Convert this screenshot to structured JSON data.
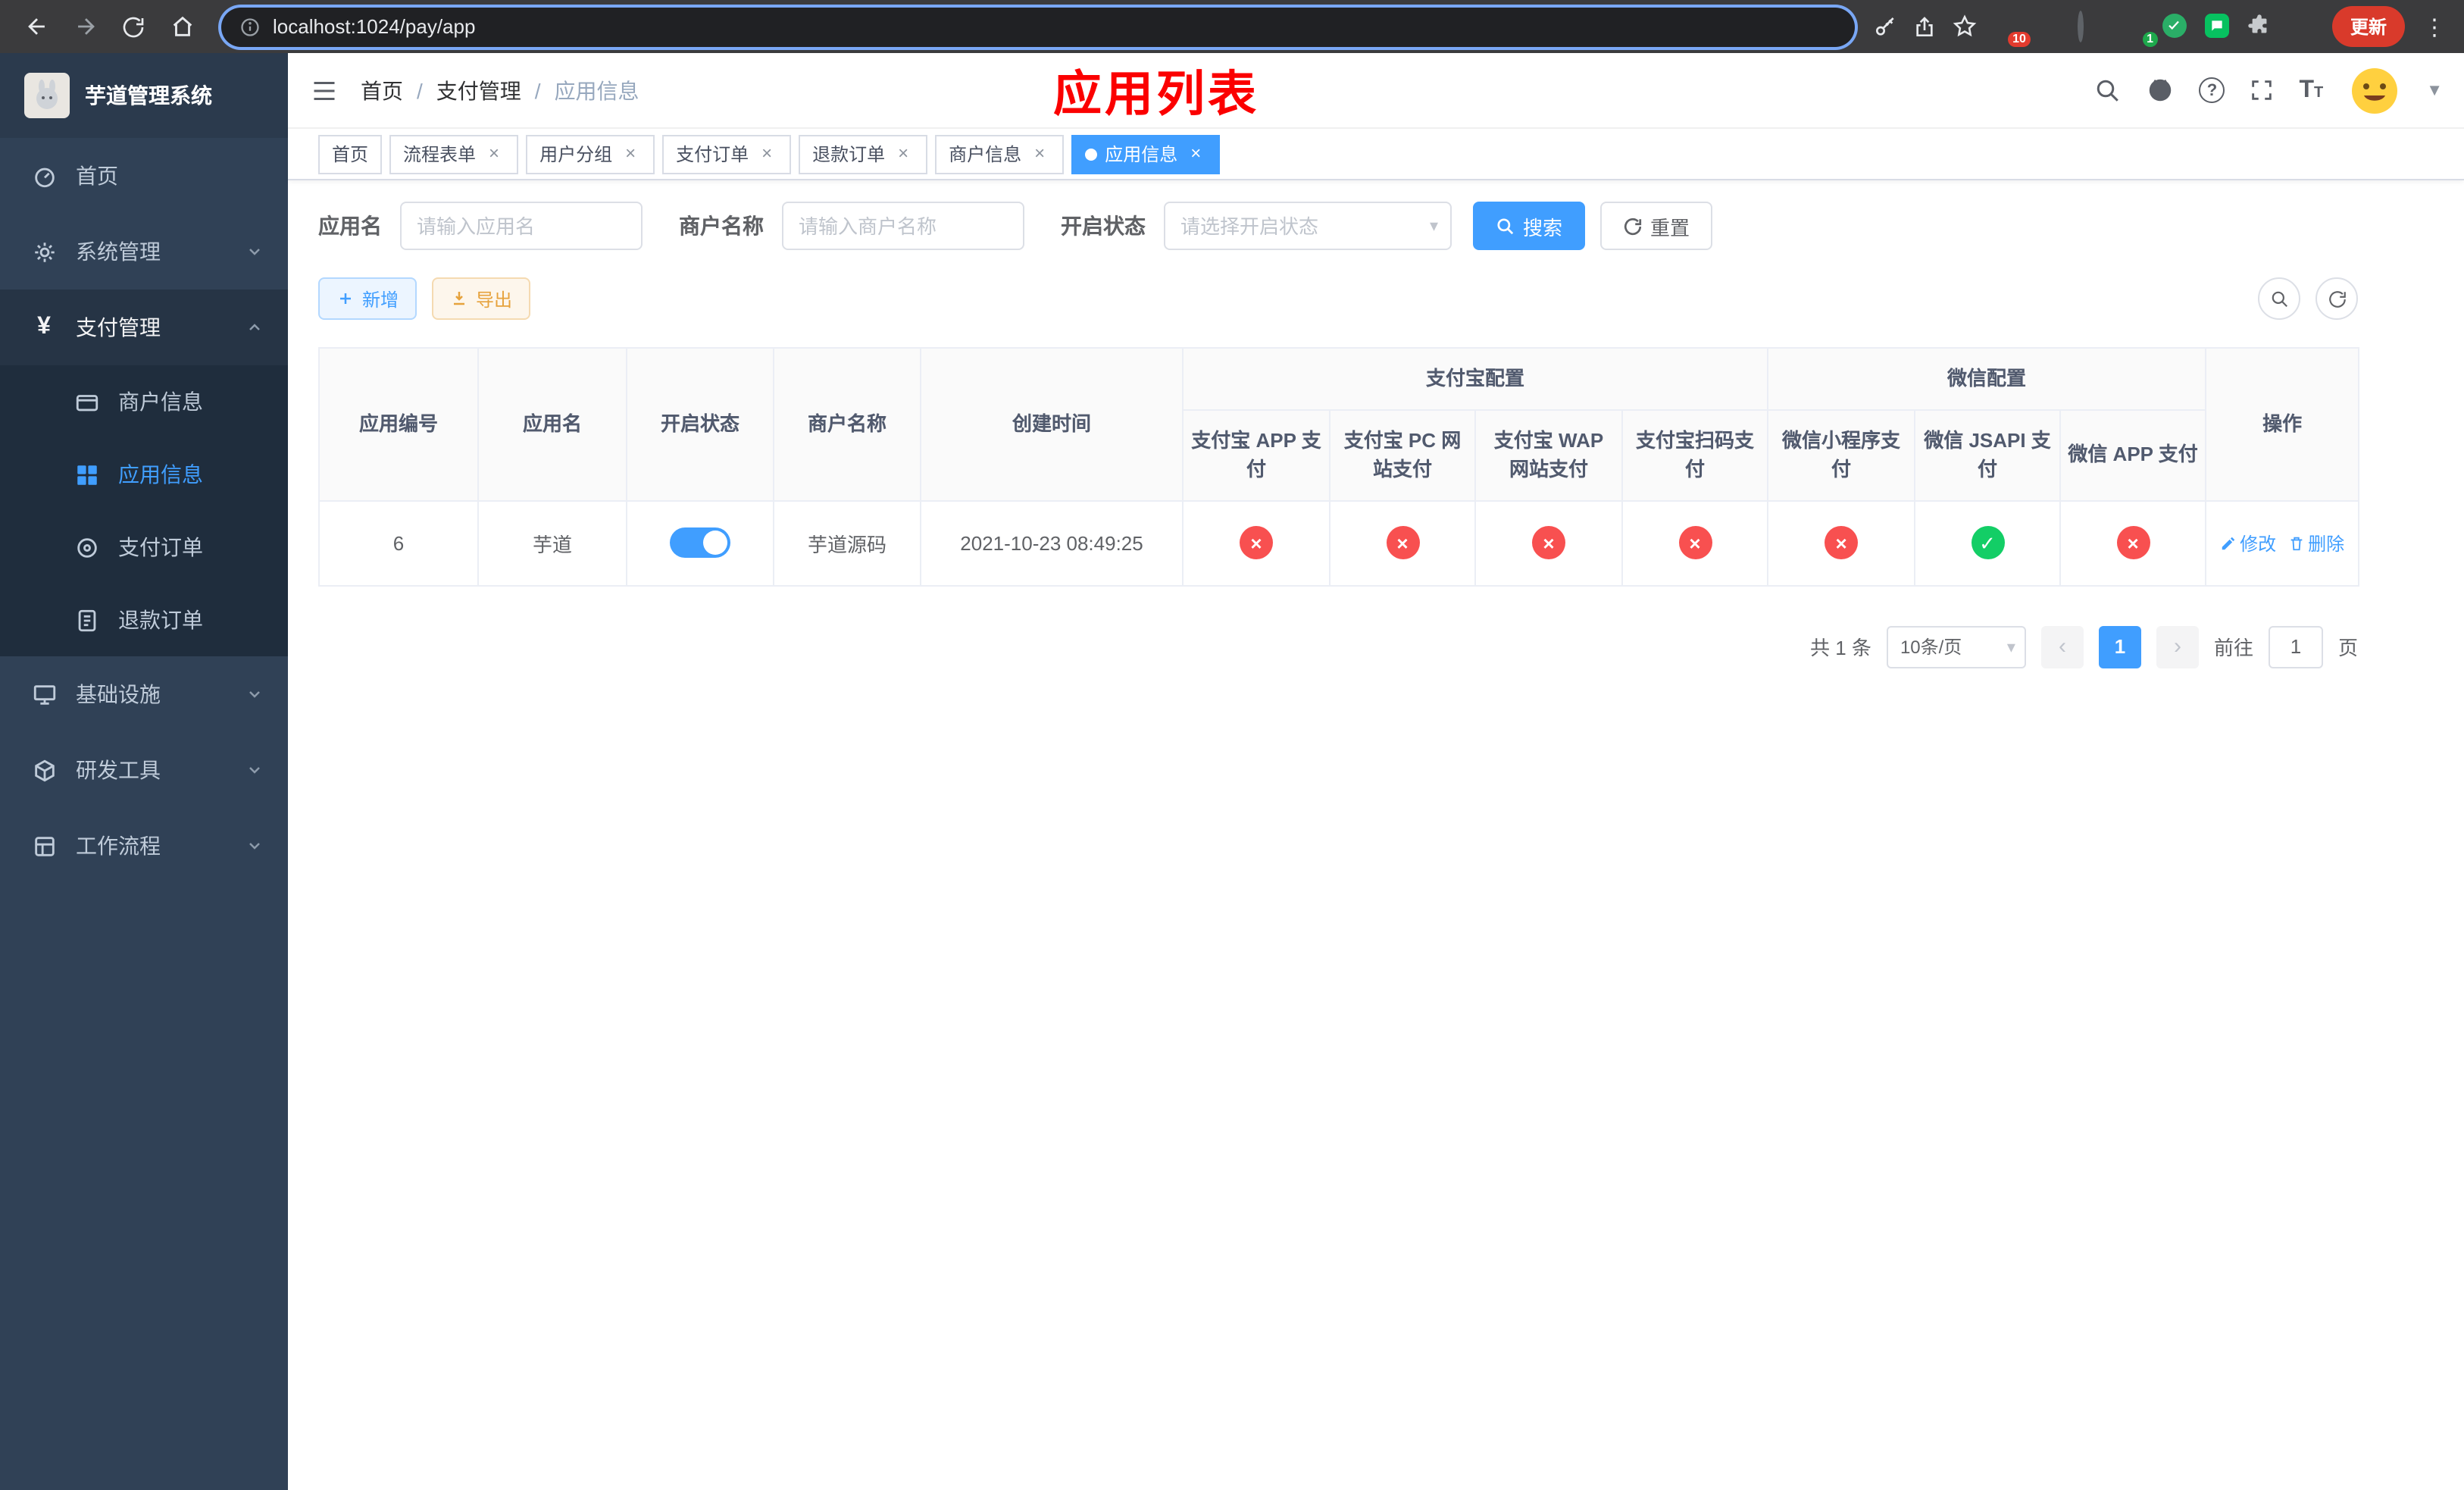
{
  "browser": {
    "url": "localhost:1024/pay/app",
    "update_button": "更新",
    "extension_badge_grid": "10",
    "extension_badge_avatar": "1"
  },
  "header": {
    "breadcrumb": [
      "首页",
      "支付管理",
      "应用信息"
    ],
    "annotation": "应用列表"
  },
  "sidebar": {
    "title": "芋道管理系统",
    "items": {
      "home": "首页",
      "system": "系统管理",
      "payment": "支付管理",
      "merchant_info": "商户信息",
      "app_info": "应用信息",
      "pay_order": "支付订单",
      "refund_order": "退款订单",
      "infra": "基础设施",
      "dev_tools": "研发工具",
      "workflow": "工作流程"
    }
  },
  "tags": {
    "items": [
      {
        "label": "首页",
        "closable": false,
        "active": false
      },
      {
        "label": "流程表单",
        "closable": true,
        "active": false
      },
      {
        "label": "用户分组",
        "closable": true,
        "active": false
      },
      {
        "label": "支付订单",
        "closable": true,
        "active": false
      },
      {
        "label": "退款订单",
        "closable": true,
        "active": false
      },
      {
        "label": "商户信息",
        "closable": true,
        "active": false
      },
      {
        "label": "应用信息",
        "closable": true,
        "active": true
      }
    ]
  },
  "filters": {
    "app_name_label": "应用名",
    "app_name_placeholder": "请输入应用名",
    "merchant_label": "商户名称",
    "merchant_placeholder": "请输入商户名称",
    "status_label": "开启状态",
    "status_placeholder": "请选择开启状态",
    "search_label": "搜索",
    "reset_label": "重置"
  },
  "toolbar": {
    "add_label": "新增",
    "export_label": "导出"
  },
  "table": {
    "group_alipay": "支付宝配置",
    "group_wechat": "微信配置",
    "columns": {
      "app_id": "应用编号",
      "app_name": "应用名",
      "status": "开启状态",
      "merchant": "商户名称",
      "created": "创建时间",
      "alipay_app": "支付宝 APP 支付",
      "alipay_pc": "支付宝 PC 网站支付",
      "alipay_wap": "支付宝 WAP 网站支付",
      "alipay_qr": "支付宝扫码支付",
      "wx_mini": "微信小程序支付",
      "wx_jsapi": "微信 JSAPI 支付",
      "wx_app": "微信 APP 支付",
      "actions": "操作"
    },
    "row": {
      "id": "6",
      "name": "芋道",
      "status_on": true,
      "merchant": "芋道源码",
      "created_at": "2021-10-23 08:49:25",
      "channel_status": [
        false,
        false,
        false,
        false,
        false,
        true,
        false
      ],
      "edit_label": "修改",
      "delete_label": "删除"
    }
  },
  "pagination": {
    "total": "共 1 条",
    "page_size": "10条/页",
    "current_page": "1",
    "goto_prefix": "前往",
    "goto_value": "1",
    "goto_suffix": "页"
  }
}
